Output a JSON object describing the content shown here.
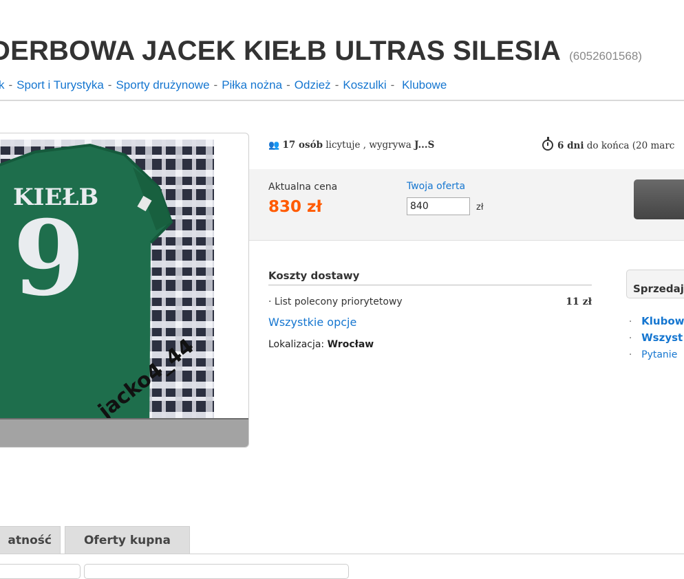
{
  "header": {
    "title": "DERBOWA JACEK KIEŁB ULTRAS SILESIA",
    "item_id": "(6052601568)"
  },
  "breadcrumb": [
    "k",
    "Sport i Turystyka",
    "Sporty drużynowe",
    "Piłka nożna",
    "Odzież",
    "Koszulki",
    "Klubowe"
  ],
  "photo": {
    "jersey_name": "KIEŁB",
    "jersey_number": "9",
    "watermark": "jacko4_44",
    "colors": {
      "jersey": "#1e6e4c",
      "blanket": "#3a3f52"
    }
  },
  "stats": {
    "bidders_count": "17 osób",
    "bidders_text": "licytuje , wygrywa",
    "winner": "J...S",
    "days": "6 dni",
    "ends_text": "do końca (20 marc"
  },
  "price": {
    "current_label": "Aktualna cena",
    "current_value": "830 zł",
    "offer_label": "Twoja oferta",
    "offer_value": "840",
    "offer_unit": "zł"
  },
  "delivery": {
    "title": "Koszty dostawy",
    "method": "· List polecony priorytetowy",
    "cost": "11 zł",
    "all_options": "Wszystkie opcje",
    "location_label": "Lokalizacja:",
    "location_value": "Wrocław"
  },
  "seller": {
    "title": "Sprzedaj",
    "links": [
      "Klubow",
      "Wszyst",
      "Pytanie"
    ],
    "bullet": "·"
  },
  "tabs": [
    "atność",
    "Oferty kupna"
  ],
  "colors": {
    "accent_link": "#1576d0",
    "price": "#ff5a00"
  }
}
